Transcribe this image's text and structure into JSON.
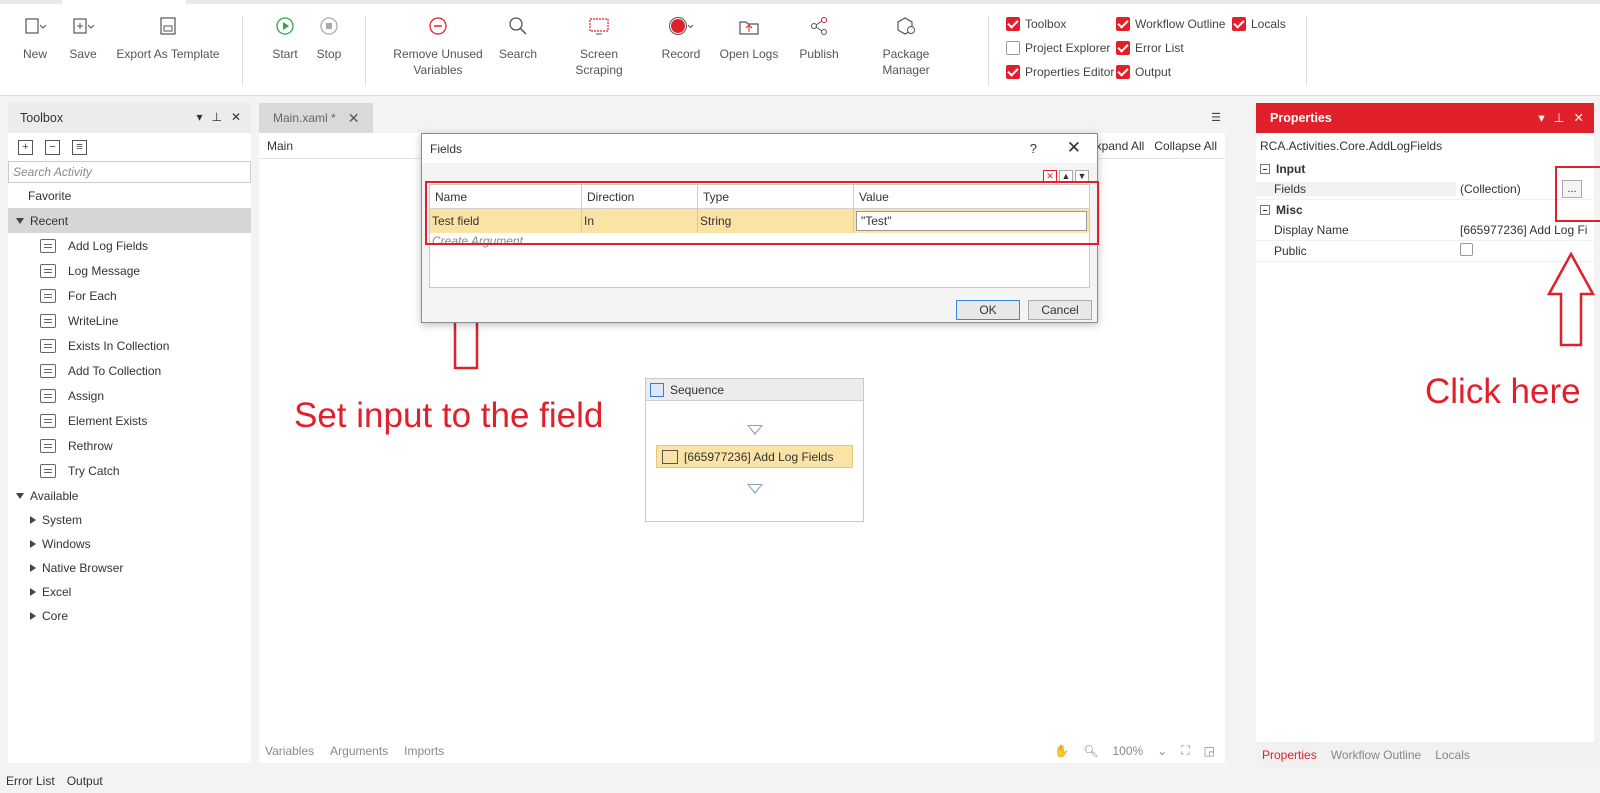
{
  "ribbon": {
    "new": "New",
    "save": "Save",
    "export": "Export As Template",
    "start": "Start",
    "stop": "Stop",
    "remove_unused_1": "Remove Unused",
    "remove_unused_2": "Variables",
    "search": "Search",
    "screen_scraping": "Screen Scraping",
    "record": "Record",
    "open_logs": "Open Logs",
    "publish": "Publish",
    "package_manager": "Package Manager",
    "checks": {
      "toolbox": "Toolbox",
      "project_explorer": "Project Explorer",
      "properties_editor": "Properties Editor",
      "workflow_outline": "Workflow Outline",
      "error_list": "Error List",
      "output": "Output",
      "locals": "Locals"
    }
  },
  "toolbox": {
    "title": "Toolbox",
    "search_placeholder": "Search Activity",
    "favorite": "Favorite",
    "recent": "Recent",
    "recent_items": [
      "Add Log Fields",
      "Log Message",
      "For Each",
      "WriteLine",
      "Exists In Collection",
      "Add To Collection",
      "Assign",
      "Element Exists",
      "Rethrow",
      "Try Catch"
    ],
    "available": "Available",
    "available_items": [
      "System",
      "Windows",
      "Native Browser",
      "Excel",
      "Core"
    ]
  },
  "designer": {
    "tab": "Main.xaml *",
    "breadcrumb": "Main",
    "expand_all": "Expand All",
    "collapse_all": "Collapse All",
    "sequence_title": "Sequence",
    "activity": "[665977236] Add Log Fields",
    "footer": [
      "Variables",
      "Arguments",
      "Imports"
    ],
    "zoom": "100%"
  },
  "dialog": {
    "title": "Fields",
    "help": "?",
    "columns": [
      "Name",
      "Direction",
      "Type",
      "Value"
    ],
    "row": {
      "name": "Test field",
      "direction": "In",
      "type": "String",
      "value": "\"Test\""
    },
    "create_argument": "Create Argument",
    "ok": "OK",
    "cancel": "Cancel"
  },
  "properties": {
    "title": "Properties",
    "type_name": "RCA.Activities.Core.AddLogFields",
    "input_cat": "Input",
    "fields_label": "Fields",
    "fields_value": "(Collection)",
    "ellipsis": "...",
    "misc_cat": "Misc",
    "display_name_label": "Display Name",
    "display_name_value": "[665977236] Add Log Fi",
    "public_label": "Public",
    "tabs": [
      "Properties",
      "Workflow Outline",
      "Locals"
    ]
  },
  "annotations": {
    "set_input": "Set input to the field",
    "click_here": "Click here"
  },
  "bottom": {
    "error_list": "Error List",
    "output": "Output"
  },
  "colors": {
    "accent": "#e0202a",
    "highlight": "#fbe3a6"
  }
}
